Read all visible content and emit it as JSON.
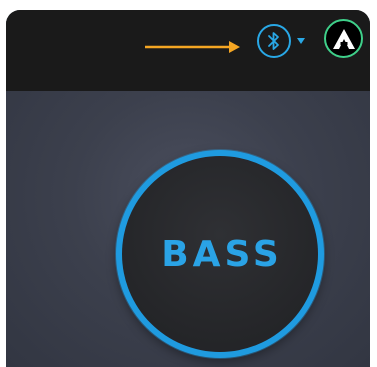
{
  "topbar": {
    "bluetooth_icon": "bluetooth-icon",
    "dropdown_icon": "caret-down-icon",
    "avatar_letter": "A",
    "annotation_icon": "arrow-right-icon"
  },
  "main": {
    "bass_button_label": "BASS"
  },
  "colors": {
    "accent_blue": "#29a8e6",
    "avatar_ring_green": "#3fd08a",
    "annotation_orange": "#f5a623",
    "topbar_bg": "#1a1a1a",
    "panel_bg": "#3a3e4c"
  }
}
